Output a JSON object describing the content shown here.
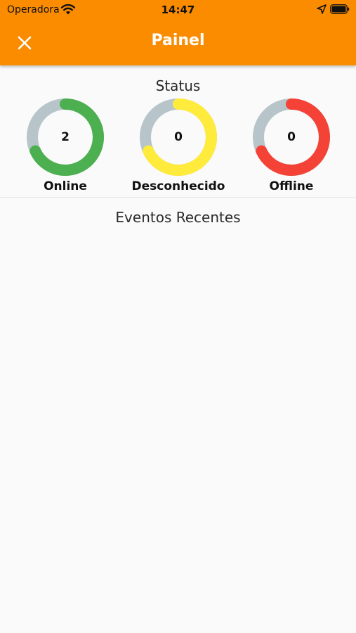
{
  "status_bar": {
    "carrier": "Operadora",
    "time": "14:47"
  },
  "header": {
    "title": "Painel",
    "close_icon": "close-icon",
    "background_color": "#fb8c00"
  },
  "status_section": {
    "title": "Status",
    "track_color": "#b7c5cb",
    "items": [
      {
        "label": "Online",
        "value": "2",
        "color": "#4caf50",
        "fill_fraction": 0.68
      },
      {
        "label": "Desconhecido",
        "value": "0",
        "color": "#ffeb3b",
        "fill_fraction": 0.68
      },
      {
        "label": "Offline",
        "value": "0",
        "color": "#f44336",
        "fill_fraction": 0.68
      }
    ]
  },
  "recent_events": {
    "title": "Eventos Recentes"
  }
}
